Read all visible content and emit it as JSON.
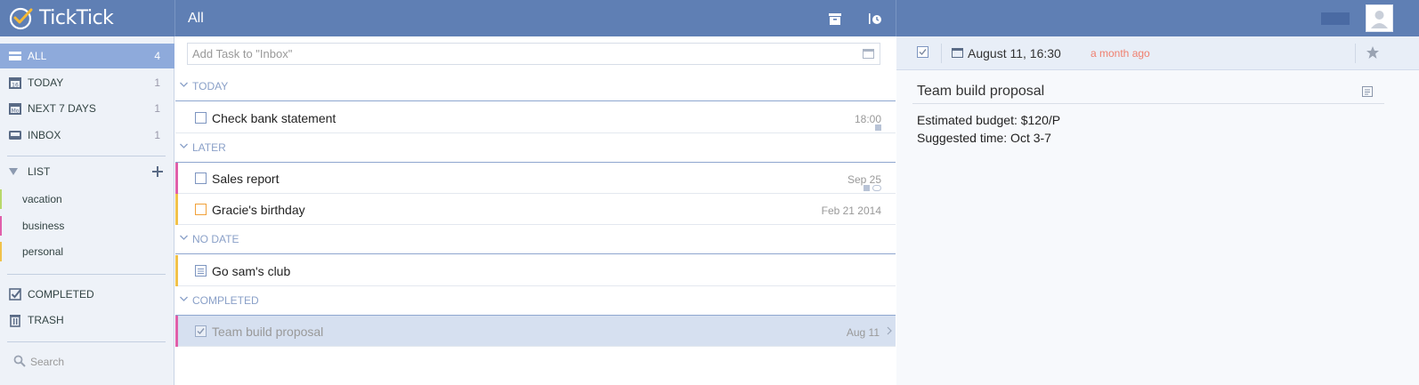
{
  "app": {
    "name": "TickTick"
  },
  "header": {
    "title": "All"
  },
  "sidebar": {
    "nav": [
      {
        "label": "ALL",
        "count": "4",
        "icon": "inbox-tray-icon"
      },
      {
        "label": "TODAY",
        "count": "1",
        "icon": "calendar-today-icon"
      },
      {
        "label": "NEXT 7 DAYS",
        "count": "1",
        "icon": "calendar-week-icon"
      },
      {
        "label": "INBOX",
        "count": "1",
        "icon": "inbox-icon"
      }
    ],
    "list_header": "LIST",
    "lists": [
      {
        "label": "vacation",
        "color": "#b8d86b"
      },
      {
        "label": "business",
        "color": "#e05faa"
      },
      {
        "label": "personal",
        "color": "#f1c24a"
      }
    ],
    "bottom": [
      {
        "label": "COMPLETED",
        "icon": "checkbox-icon"
      },
      {
        "label": "TRASH",
        "icon": "trash-icon"
      }
    ],
    "search_placeholder": "Search"
  },
  "tasklist": {
    "add_placeholder": "Add Task to \"Inbox\"",
    "sections": [
      {
        "label": "TODAY"
      },
      {
        "label": "LATER"
      },
      {
        "label": "NO DATE"
      },
      {
        "label": "COMPLETED"
      }
    ],
    "tasks": [
      {
        "title": "Check bank statement",
        "date": "18:00",
        "bar_color": ""
      },
      {
        "title": "Sales report",
        "date": "Sep 25",
        "bar_color": "#e05faa"
      },
      {
        "title": "Gracie's birthday",
        "date": "Feb 21 2014",
        "bar_color": "#f1c24a"
      },
      {
        "title": "Go sam's club",
        "date": "",
        "bar_color": "#f1c24a"
      },
      {
        "title": "Team build proposal",
        "date": "Aug 11",
        "bar_color": "#e05faa"
      }
    ]
  },
  "detail": {
    "date": "August 11, 16:30",
    "ago": "a month ago",
    "title": "Team build proposal",
    "body_lines": [
      "Estimated budget: $120/P",
      "Suggested time: Oct 3-7"
    ]
  },
  "colors": {
    "accent": "#5f7fb4",
    "active_nav": "#8eaadb",
    "overdue": "#f07f6e"
  }
}
